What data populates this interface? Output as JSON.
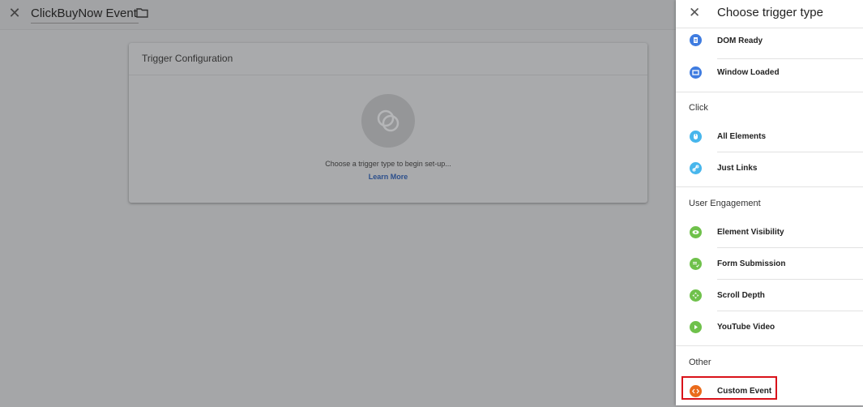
{
  "page": {
    "title": "ClickBuyNow Event"
  },
  "card": {
    "header": "Trigger Configuration",
    "message": "Choose a trigger type to begin set-up...",
    "link": "Learn More"
  },
  "panel": {
    "title": "Choose trigger type",
    "items_top": [
      {
        "label": "DOM Ready",
        "color": "#3f7ce0",
        "icon": "document-icon"
      },
      {
        "label": "Window Loaded",
        "color": "#3f7ce0",
        "icon": "window-icon"
      }
    ],
    "sections": [
      {
        "title": "Click",
        "items": [
          {
            "label": "All Elements",
            "color": "#47b6ec",
            "icon": "mouse-icon"
          },
          {
            "label": "Just Links",
            "color": "#47b6ec",
            "icon": "link-icon"
          }
        ]
      },
      {
        "title": "User Engagement",
        "items": [
          {
            "label": "Element Visibility",
            "color": "#6fc14b",
            "icon": "eye-icon"
          },
          {
            "label": "Form Submission",
            "color": "#6fc14b",
            "icon": "form-icon"
          },
          {
            "label": "Scroll Depth",
            "color": "#6fc14b",
            "icon": "scroll-icon"
          },
          {
            "label": "YouTube Video",
            "color": "#6fc14b",
            "icon": "play-icon"
          }
        ]
      },
      {
        "title": "Other",
        "items": [
          {
            "label": "Custom Event",
            "color": "#ea6b1b",
            "icon": "code-icon"
          }
        ]
      }
    ]
  }
}
